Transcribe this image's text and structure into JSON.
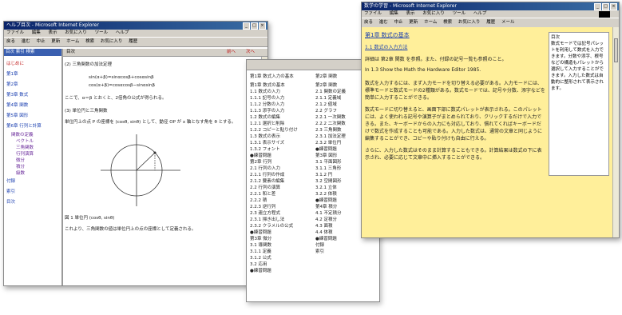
{
  "win1": {
    "title": "ヘルプ目次 - Microsoft Internet Explorer",
    "menu": [
      "ファイル",
      "編集",
      "表示",
      "お気に入り",
      "ツール",
      "ヘルプ"
    ],
    "toolbar": [
      "戻る",
      "進む",
      "中止",
      "更新",
      "ホーム",
      "検索",
      "お気に入り",
      "履歴"
    ],
    "left_header": "目次 索引 検索",
    "panel_top_label": "目次",
    "sidebar": [
      "はじめに",
      "第1章",
      "第2章",
      "第3章 数式",
      "第4章 関数",
      "第5章 図形",
      "第6章 行列と計算",
      "付録",
      "索引",
      "目次"
    ],
    "sidebar_tree": [
      "関数の定義",
      "ベクトル",
      "三角関数",
      "行列演算",
      "微分",
      "積分",
      "級数"
    ],
    "content": {
      "heading": "(2) 三角関数の加法定理",
      "formula1": "sin(α+β)=sinαcosβ+cosαsinβ",
      "formula2": "cos(α+β)=cosαcosβ−sinαsinβ",
      "para1": "ここで、α＝β とおくと、2倍角の公式が得られる。",
      "subheading": "(3) 単位円と三角関数",
      "para2": "単位円上の点 P の座標を (cosθ, sinθ) として、動径 OP が x 軸となす角を θ とする。",
      "fig_caption": "図 1 単位円 (cosθ, sinθ)",
      "para3": "これより、三角関数の値は単位円上の点の座標として定義される。",
      "nav_prev": "前へ",
      "nav_next": "次へ"
    }
  },
  "win2": {
    "title": "目次",
    "col1_heading": "第1章 数式入力の基本",
    "col2_heading": "第2章 関数",
    "col1": [
      "第1章 数式の基本",
      "1.1 数式の入力",
      "1.1.1 記号の入力",
      "1.1.2 分数の入力",
      "1.1.3 添字の入力",
      "1.2 数式の編集",
      "1.2.1 選択と削除",
      "1.2.2 コピーと貼り付け",
      "1.3 数式の表示",
      "1.3.1 表示サイズ",
      "1.3.2 フォント",
      "●練習問題",
      "第2章 行列",
      "2.1 行列の入力",
      "2.1.1 行列の作成",
      "2.1.2 要素の編集",
      "2.2 行列の演算",
      "2.2.1 和と差",
      "2.2.2 積",
      "2.2.3 逆行列",
      "2.3 連立方程式",
      "2.3.1 掃き出し法",
      "2.3.2 クラメルの公式",
      "●練習問題",
      "第3章 微分",
      "3.1 導関数",
      "3.1.1 定義",
      "3.1.2 公式",
      "3.2 応用",
      "●練習問題"
    ],
    "col2": [
      "第2章 関数",
      "2.1 関数の定義",
      "2.1.1 定義域",
      "2.1.2 値域",
      "2.2 グラフ",
      "2.2.1 一次関数",
      "2.2.2 二次関数",
      "2.3 三角関数",
      "2.3.1 加法定理",
      "2.3.2 単位円",
      "●練習問題",
      "第3章 図形",
      "3.1 平面図形",
      "3.1.1 三角形",
      "3.1.2 円",
      "3.2 空間図形",
      "3.2.1 立体",
      "3.2.2 体積",
      "●練習問題",
      "第4章 積分",
      "4.1 不定積分",
      "4.2 定積分",
      "4.3 面積",
      "4.4 体積",
      "●練習問題",
      "付録",
      "索引"
    ]
  },
  "win3": {
    "title": "数学の学習 - Microsoft Internet Explorer",
    "menu": [
      "ファイル",
      "編集",
      "表示",
      "お気に入り",
      "ツール",
      "ヘルプ"
    ],
    "toolbar": [
      "戻る",
      "進む",
      "中止",
      "更新",
      "ホーム",
      "検索",
      "お気に入り",
      "履歴",
      "メール"
    ],
    "heading": "第1章 数式の基本",
    "subheading": "1.1 数式の入力方法",
    "link_para": "詳細は 第2章 関数 を参照。また、付録の記号一覧も参照のこと。",
    "english_para": "In 1.3 Show the Math the Hardware Editor 1985.",
    "para1": "数式を入力するには、まず入力モードを切り替える必要がある。入力モードには、標準モードと数式モードの2種類がある。数式モードでは、記号や分数、添字などを簡単に入力することができる。",
    "para2": "数式モードに切り替えると、画面下部に数式パレットが表示される。このパレットには、よく使われる記号や演算子がまとめられており、クリックするだけで入力できる。また、キーボードからの入力にも対応しており、慣れてくればキーボードだけで数式を作成することも可能である。入力した数式は、通常の文章と同じように編集することができ、コピーや貼り付けも自由に行える。",
    "para3": "さらに、入力した数式はそのまま計算することもできる。計算結果は数式の下に表示され、必要に応じて文章中に挿入することができる。",
    "side_label": "目次",
    "side_text": "数式モードでは記号パレットを利用して数式を入力できます。分数や添字、根号などの構造もパレットから選択して入力することができます。入力した数式は自動的に整形されて表示されます。"
  }
}
